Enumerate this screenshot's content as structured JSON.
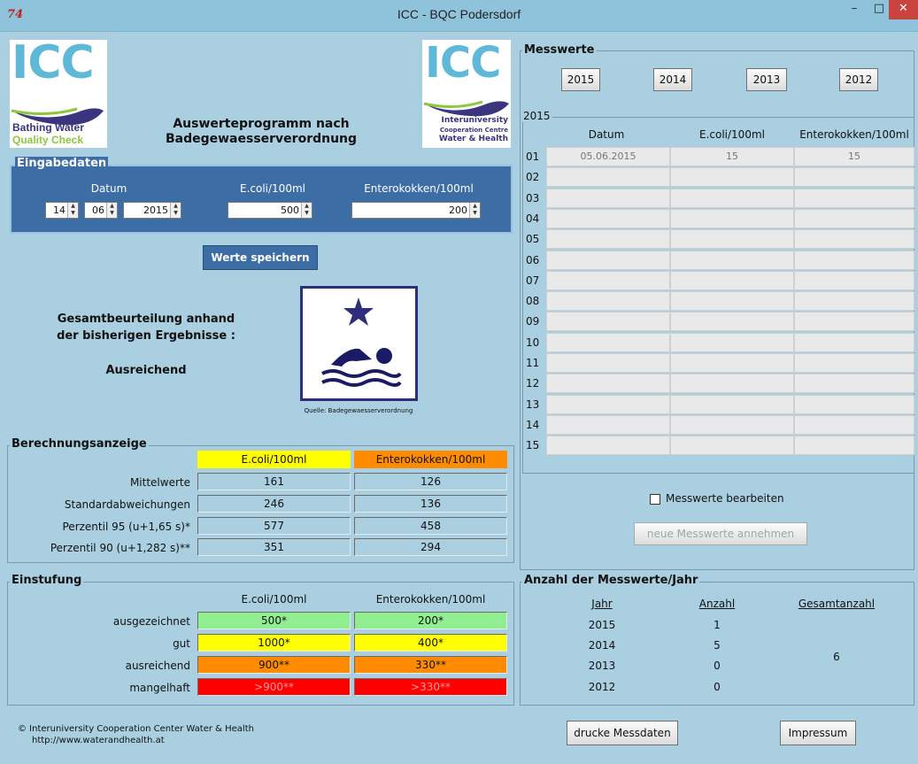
{
  "window": {
    "title": "ICC - BQC Podersdorf",
    "app_icon": "74",
    "min": "–",
    "max": "□",
    "close": "✕"
  },
  "logos": {
    "left": {
      "mark": "ICC",
      "line1": "Bathing Water",
      "line2": "Quality Check"
    },
    "right": {
      "mark": "ICC",
      "line1": "Interuniversity",
      "line2": "Cooperation Centre",
      "line3": "Water & Health"
    }
  },
  "heading": {
    "line1": "Auswerteprogramm nach",
    "line2": "Badegewaesserverordnung"
  },
  "eingabe": {
    "legend": "Eingabedaten",
    "datum_label": "Datum",
    "ecoli_label": "E.coli/100ml",
    "entero_label": "Enterokokken/100ml",
    "day": "14",
    "month": "06",
    "year": "2015",
    "ecoli_value": "500",
    "entero_value": "200"
  },
  "save_button": "Werte speichern",
  "assessment": {
    "line1": "Gesamtbeurteilung anhand",
    "line2": "der bisherigen Ergebnisse :",
    "result": "Ausreichend",
    "source": "Quelle: Badegewaesserverordnung",
    "icon": "swimmer-one-star"
  },
  "berechnung": {
    "legend": "Berechnungsanzeige",
    "col1": "E.coli/100ml",
    "col2": "Enterokokken/100ml",
    "rows": [
      {
        "label": "Mittelwerte",
        "ecoli": "161",
        "entero": "126"
      },
      {
        "label": "Standardabweichungen",
        "ecoli": "246",
        "entero": "136"
      },
      {
        "label": "Perzentil 95 (u+1,65 s)*",
        "ecoli": "577",
        "entero": "458"
      },
      {
        "label": "Perzentil 90 (u+1,282 s)**",
        "ecoli": "351",
        "entero": "294"
      }
    ]
  },
  "einstufung": {
    "legend": "Einstufung",
    "col1": "E.coli/100ml",
    "col2": "Enterokokken/100ml",
    "rows": [
      {
        "label": "ausgezeichnet",
        "ecoli": "500*",
        "entero": "200*",
        "color": "#90ee90"
      },
      {
        "label": "gut",
        "ecoli": "1000*",
        "entero": "400*",
        "color": "#ffff00"
      },
      {
        "label": "ausreichend",
        "ecoli": "900**",
        "entero": "330**",
        "color": "#ff8c00"
      },
      {
        "label": "mangelhaft",
        "ecoli": ">900**",
        "entero": ">330**",
        "color": "#ff0000"
      }
    ]
  },
  "footer": {
    "copyright": "© Interuniversity Cooperation Center Water & Health",
    "url": "http://www.waterandhealth.at",
    "print_button": "drucke Messdaten",
    "impressum_button": "Impressum"
  },
  "messwerte": {
    "legend": "Messwerte",
    "year_buttons": [
      "2015",
      "2014",
      "2013",
      "2012"
    ],
    "sub_legend": "2015",
    "headers": [
      "Datum",
      "E.coli/100ml",
      "Enterokokken/100ml"
    ],
    "rows": [
      {
        "n": "01",
        "datum": "05.06.2015",
        "ecoli": "15",
        "entero": "15"
      },
      {
        "n": "02",
        "datum": "",
        "ecoli": "",
        "entero": ""
      },
      {
        "n": "03",
        "datum": "",
        "ecoli": "",
        "entero": ""
      },
      {
        "n": "04",
        "datum": "",
        "ecoli": "",
        "entero": ""
      },
      {
        "n": "05",
        "datum": "",
        "ecoli": "",
        "entero": ""
      },
      {
        "n": "06",
        "datum": "",
        "ecoli": "",
        "entero": ""
      },
      {
        "n": "07",
        "datum": "",
        "ecoli": "",
        "entero": ""
      },
      {
        "n": "08",
        "datum": "",
        "ecoli": "",
        "entero": ""
      },
      {
        "n": "09",
        "datum": "",
        "ecoli": "",
        "entero": ""
      },
      {
        "n": "10",
        "datum": "",
        "ecoli": "",
        "entero": ""
      },
      {
        "n": "11",
        "datum": "",
        "ecoli": "",
        "entero": ""
      },
      {
        "n": "12",
        "datum": "",
        "ecoli": "",
        "entero": ""
      },
      {
        "n": "13",
        "datum": "",
        "ecoli": "",
        "entero": ""
      },
      {
        "n": "14",
        "datum": "",
        "ecoli": "",
        "entero": ""
      },
      {
        "n": "15",
        "datum": "",
        "ecoli": "",
        "entero": ""
      }
    ],
    "edit_checkbox": "Messwerte bearbeiten",
    "edit_checked": false,
    "accept_button": "neue Messwerte annehmen"
  },
  "anzahl": {
    "legend": "Anzahl der Messwerte/Jahr",
    "col_jahr": "Jahr",
    "col_anzahl": "Anzahl",
    "col_gesamt": "Gesamtanzahl",
    "rows": [
      {
        "jahr": "2015",
        "anzahl": "1"
      },
      {
        "jahr": "2014",
        "anzahl": "5"
      },
      {
        "jahr": "2013",
        "anzahl": "0"
      },
      {
        "jahr": "2012",
        "anzahl": "0"
      }
    ],
    "gesamt": "6"
  }
}
